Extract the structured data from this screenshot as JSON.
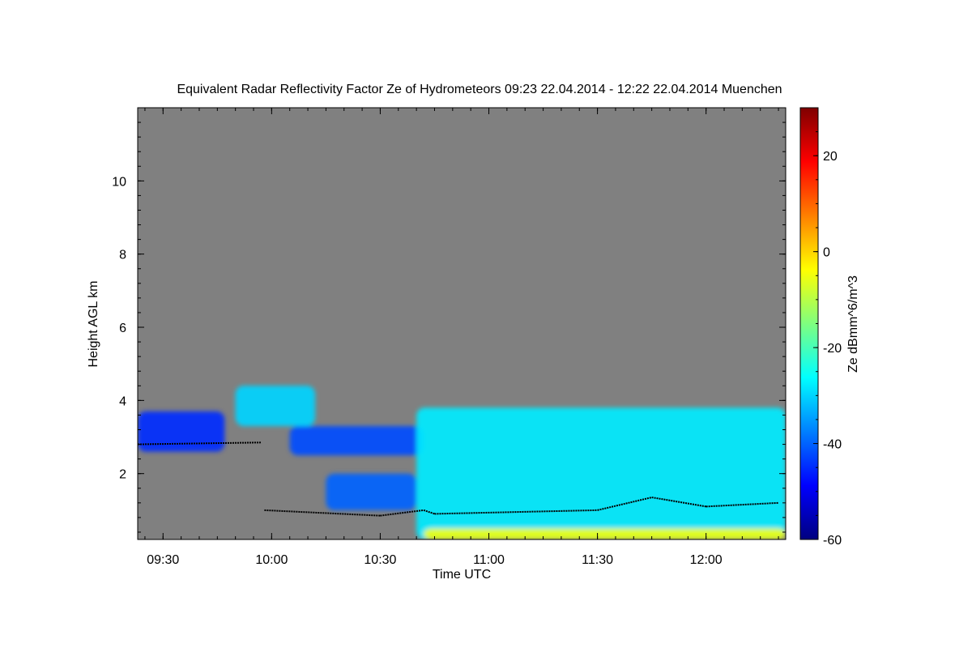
{
  "chart_data": {
    "type": "heatmap",
    "title": "Equivalent Radar Reflectivity Factor Ze of Hydrometeors   09:23 22.04.2014 - 12:22 22.04.2014 Muenchen",
    "xlabel": "Time UTC",
    "ylabel": "Height AGL km",
    "colorbar_label": "Ze dBmm^6/m^3",
    "x_range": [
      "09:23",
      "12:22"
    ],
    "x_ticks": [
      "09:30",
      "10:00",
      "10:30",
      "11:00",
      "11:30",
      "12:00"
    ],
    "y_range": [
      0.2,
      12.0
    ],
    "y_ticks": [
      2,
      4,
      6,
      8,
      10
    ],
    "color_range": [
      -60,
      30
    ],
    "color_ticks": [
      -60,
      -40,
      -20,
      0,
      20
    ],
    "colormap": "jet",
    "background_color": "#808080",
    "cloud_layers": [
      {
        "t0": "09:23",
        "t1": "09:47",
        "h0": 2.6,
        "h1": 3.7,
        "ze": -45
      },
      {
        "t0": "09:50",
        "t1": "10:12",
        "h0": 3.3,
        "h1": 4.4,
        "ze": -30
      },
      {
        "t0": "10:05",
        "t1": "10:42",
        "h0": 2.5,
        "h1": 3.3,
        "ze": -42
      },
      {
        "t0": "10:15",
        "t1": "10:40",
        "h0": 1.0,
        "h1": 2.0,
        "ze": -40
      },
      {
        "t0": "10:40",
        "t1": "12:22",
        "h0": 0.2,
        "h1": 3.8,
        "ze": -28
      },
      {
        "t0": "10:42",
        "t1": "12:22",
        "h0": 0.2,
        "h1": 0.5,
        "ze": -5
      }
    ],
    "cloud_base_height_km": [
      {
        "time": "09:23",
        "h": 2.8
      },
      {
        "time": "09:57",
        "h": 2.85
      },
      {
        "time": "09:58",
        "h": 1.0
      },
      {
        "time": "10:30",
        "h": 0.85
      },
      {
        "time": "10:42",
        "h": 1.0
      },
      {
        "time": "10:45",
        "h": 0.9
      },
      {
        "time": "11:30",
        "h": 1.0
      },
      {
        "time": "11:45",
        "h": 1.35
      },
      {
        "time": "12:00",
        "h": 1.1
      },
      {
        "time": "12:20",
        "h": 1.2
      }
    ]
  }
}
